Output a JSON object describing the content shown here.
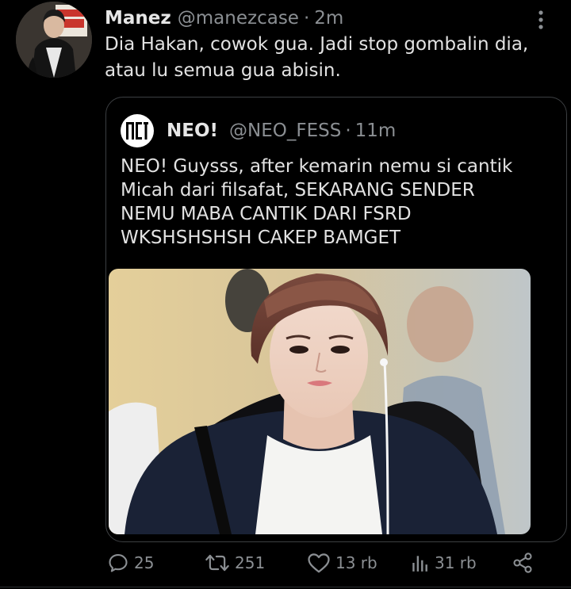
{
  "tweet": {
    "author_name": "Manez",
    "author_handle": "@manezcase",
    "separator": "·",
    "time": "2m",
    "text": "Dia Hakan, cowok gua. Jadi stop gombalin dia,\natau lu semua gua abisin.",
    "avatar_badge": "EMPLOYEES ONLY"
  },
  "quoted": {
    "name": "NEO!",
    "handle": "@NEO_FESS",
    "separator": "·",
    "time": "11m",
    "text": "NEO! Guysss, after kemarin nemu si cantik\nMicah dari filsafat, SEKARANG SENDER\nNEMU MABA CANTIK DARI FSRD\nWKSHSHSHSH CAKEP BAMGET",
    "avatar_logo": "nct"
  },
  "actions": {
    "replies": "25",
    "retweets": "251",
    "likes": "13 rb",
    "views": "31 rb"
  },
  "colors": {
    "background": "#000000",
    "text": "#e2e2e2",
    "secondary": "#8b8f93",
    "border": "#3c3f42"
  },
  "icons": [
    "more-vertical-icon",
    "reply-icon",
    "retweet-icon",
    "like-icon",
    "analytics-icon",
    "share-icon"
  ]
}
